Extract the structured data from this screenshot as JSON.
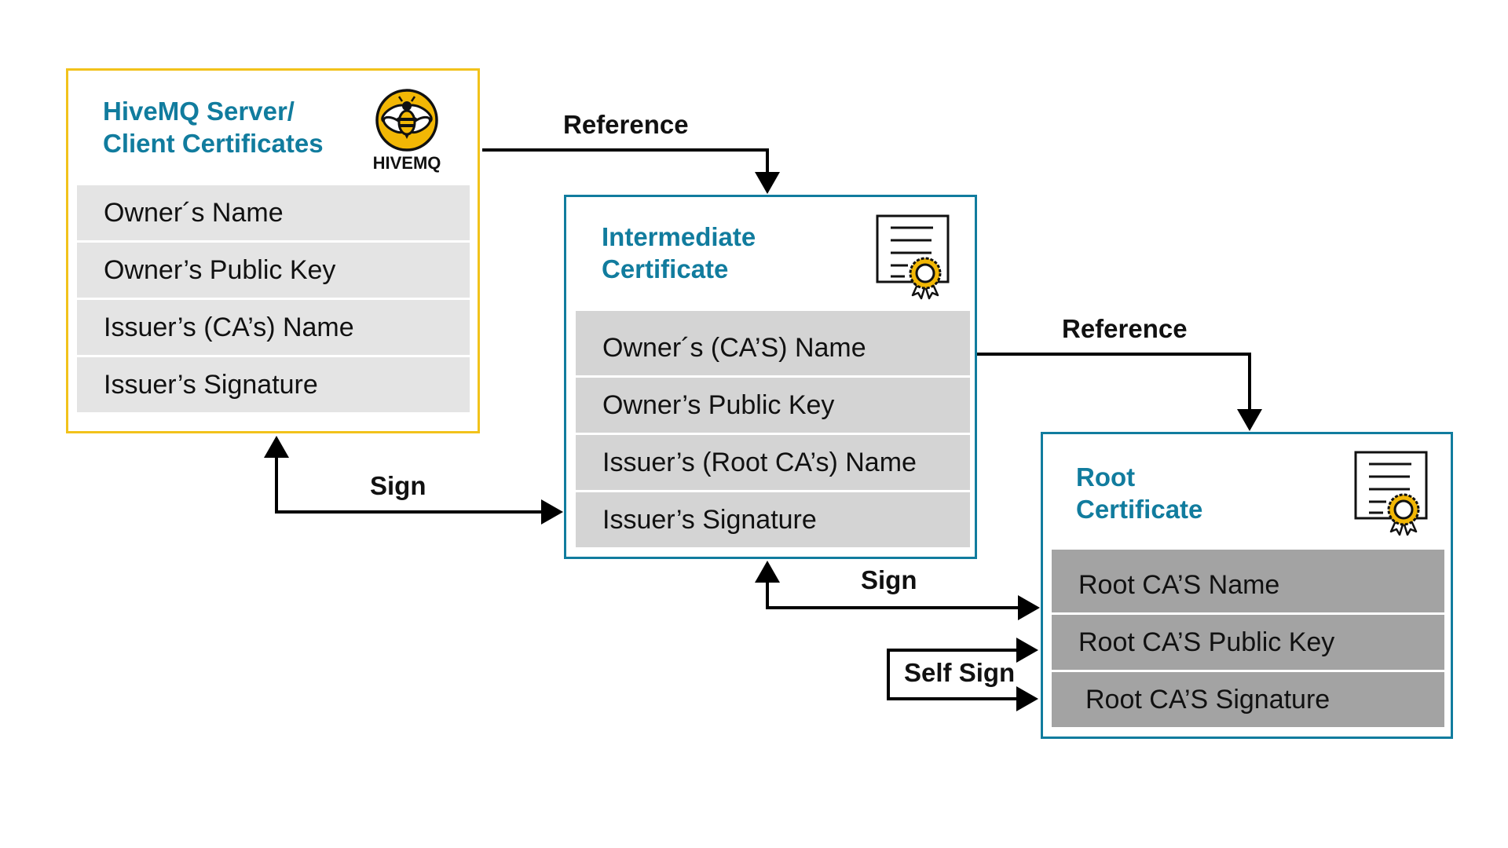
{
  "diagram": {
    "hivemq_box": {
      "title_lines": [
        "HiveMQ Server/",
        "Client Certificates"
      ],
      "logo_text": "HIVEMQ",
      "border_color": "#f2c21b",
      "fields": [
        "Owner´s Name",
        "Owner’s Public Key",
        "Issuer’s (CA’s) Name",
        "Issuer’s Signature"
      ]
    },
    "intermediate_box": {
      "title_lines": [
        "Intermediate",
        "Certificate"
      ],
      "icon": "certificate-icon",
      "border_color": "#117c9e",
      "fields": [
        "Owner´s (CA’S) Name",
        "Owner’s Public Key",
        "Issuer’s (Root  CA’s) Name",
        "Issuer’s Signature"
      ]
    },
    "root_box": {
      "title_lines": [
        "Root",
        "Certificate"
      ],
      "icon": "certificate-icon",
      "border_color": "#117c9e",
      "fields": [
        "Root CA’S Name",
        "Root CA’S Public Key",
        "Root CA’S Signature"
      ]
    },
    "connectors": [
      {
        "label": "Reference",
        "from": "hivemq_box",
        "to": "intermediate_box"
      },
      {
        "label": "Reference",
        "from": "intermediate_box",
        "to": "root_box"
      },
      {
        "label": "Sign",
        "from": "intermediate_box",
        "to": "hivemq_box"
      },
      {
        "label": "Sign",
        "from": "root_box",
        "to": "intermediate_box"
      },
      {
        "label": "Self Sign",
        "from": "root_box",
        "to": "root_box"
      }
    ],
    "colors": {
      "title": "#117c9e",
      "hivemq_accent": "#f2c21b",
      "seal_gold": "#f2b705"
    }
  }
}
